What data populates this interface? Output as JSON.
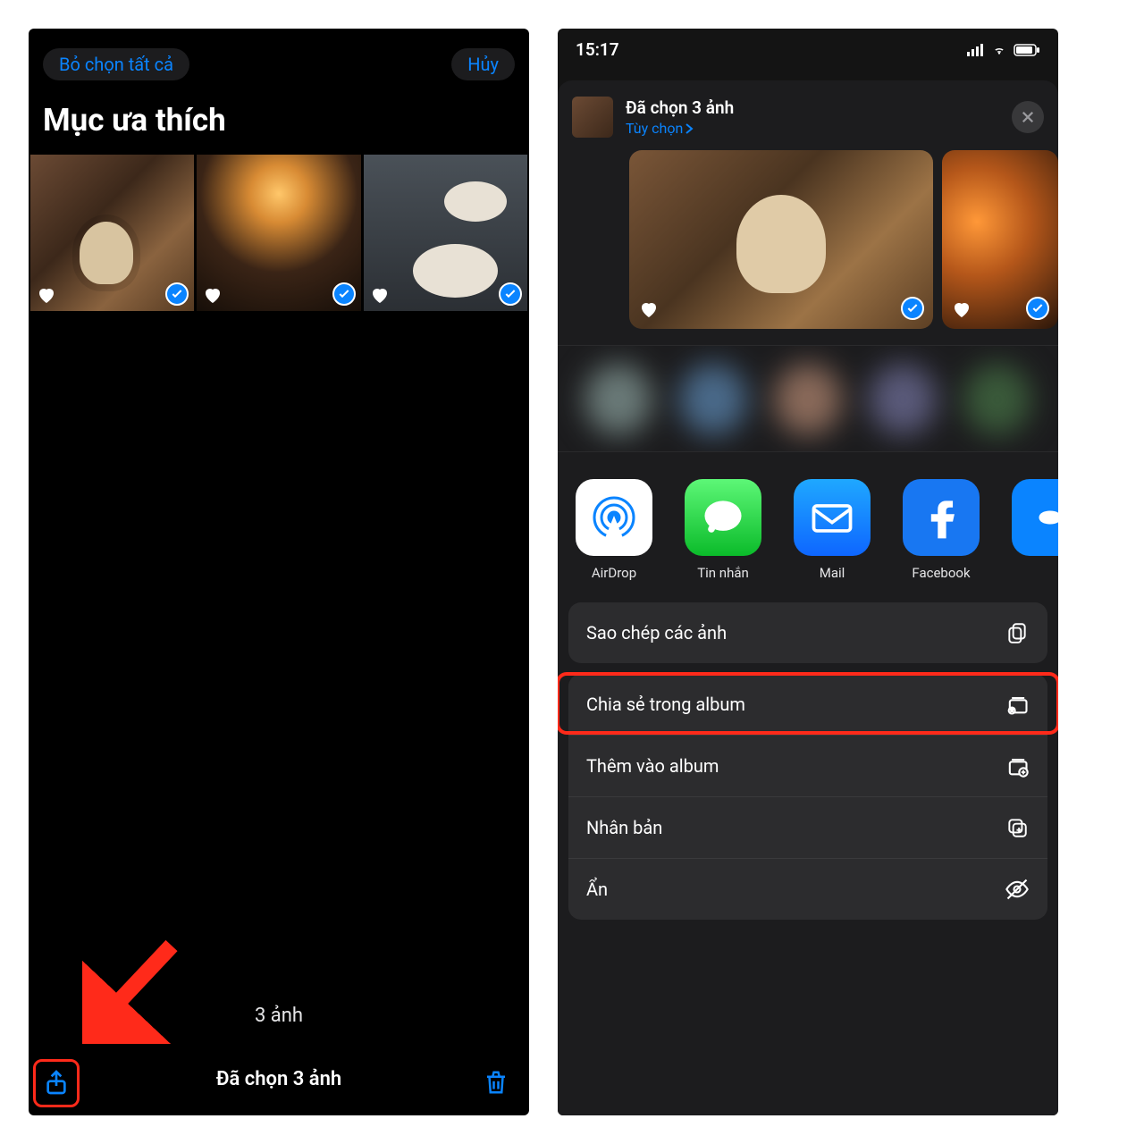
{
  "left": {
    "deselect_all": "Bỏ chọn tất cả",
    "cancel": "Hủy",
    "title": "Mục ưa thích",
    "count_text": "3 ảnh",
    "selected_text": "Đã chọn 3 ảnh"
  },
  "right": {
    "status_time": "15:17",
    "sheet_title": "Đã chọn 3 ảnh",
    "options_label": "Tùy chọn",
    "apps": [
      {
        "label": "AirDrop"
      },
      {
        "label": "Tin nhắn"
      },
      {
        "label": "Mail"
      },
      {
        "label": "Facebook"
      }
    ],
    "actions": {
      "copy": "Sao chép các ảnh",
      "share_album": "Chia sẻ trong album",
      "add_album": "Thêm vào album",
      "duplicate": "Nhân bản",
      "hide": "Ẩn"
    }
  }
}
